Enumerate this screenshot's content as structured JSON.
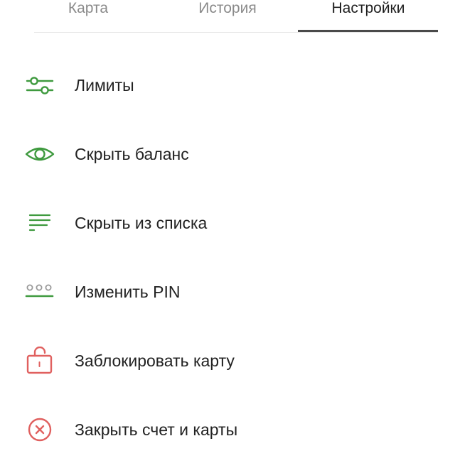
{
  "tabs": [
    {
      "label": "Карта",
      "active": false
    },
    {
      "label": "История",
      "active": false
    },
    {
      "label": "Настройки",
      "active": true
    }
  ],
  "menu": {
    "items": [
      {
        "label": "Лимиты",
        "icon": "sliders-icon"
      },
      {
        "label": "Скрыть баланс",
        "icon": "eye-icon"
      },
      {
        "label": "Скрыть из списка",
        "icon": "list-lines-icon"
      },
      {
        "label": "Изменить PIN",
        "icon": "pin-dots-icon"
      },
      {
        "label": "Заблокировать карту",
        "icon": "lock-icon"
      },
      {
        "label": "Закрыть счет и карты",
        "icon": "close-circle-icon"
      }
    ]
  },
  "colors": {
    "accent_green": "#3f9a3f",
    "danger_red": "#e0605f",
    "pin_dots_gray": "#9a9a9a",
    "active_tab_underline": "#4a4a4a"
  }
}
